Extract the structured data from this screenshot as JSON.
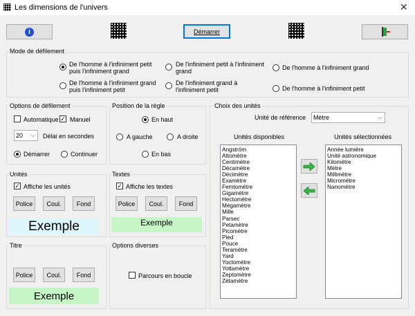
{
  "window": {
    "title": "Les dimensions de l'univers",
    "close_glyph": "✕"
  },
  "toolbar": {
    "start_label": "Démarrer",
    "info_glyph": "i"
  },
  "scroll_mode": {
    "title": "Mode de défilement",
    "options": [
      "De l'homme à l'infiniment petit puis l'infiniment grand",
      "De l'infiniment petit à l'infiniment grand",
      "De l'homme à l'infiniment grand",
      "De l'homme à l'infiniment grand puis l'infiniment petit",
      "De l'infiniment grand à l'infiniment petit",
      "De l'homme à l'infiniment petit"
    ]
  },
  "scroll_options": {
    "title": "Options de défilement",
    "auto_label": "Automatique",
    "manual_label": "Manuel",
    "delay_value": "20",
    "delay_label": "Délai en secondes",
    "start_label": "Démarrer",
    "continue_label": "Continuer"
  },
  "ruler": {
    "title": "Position de la règle",
    "top": "En haut",
    "left": "A gauche",
    "right": "A droite",
    "bottom": "En bas"
  },
  "units_box": {
    "title": "Unités",
    "show_label": "Affiche les unités",
    "font": "Police",
    "color": "Coul.",
    "bg": "Fond",
    "sample": "Exemple",
    "sample_bg": "#ddf6fc"
  },
  "texts_box": {
    "title": "Textes",
    "show_label": "Affiche les textes",
    "font": "Police",
    "color": "Coul.",
    "bg": "Fond",
    "sample": "Exemple",
    "sample_bg": "#c6f5c6"
  },
  "title_box": {
    "title": "Titre",
    "font": "Police",
    "color": "Coul.",
    "bg": "Fond",
    "sample": "Exemple",
    "sample_bg": "#c6f5c6"
  },
  "misc": {
    "title": "Options diverses",
    "loop_label": "Parcours en boucle"
  },
  "units_choice": {
    "title": "Choix des unités",
    "ref_label": "Unité de référence",
    "ref_value": "Mètre",
    "available_label": "Unités disponibles",
    "selected_label": "Unités sélectionnées",
    "available": [
      "Angström",
      "Attomètre",
      "Centimètre",
      "Décamètre",
      "Décimètre",
      "Examètre",
      "Femtomètre",
      "Gigamètre",
      "Hectomètre",
      "Mégamètre",
      "Mille",
      "Parsec",
      "Petamètre",
      "Picomètre",
      "Pied",
      "Pouce",
      "Teramètre",
      "Yard",
      "Yoctomètre",
      "Yottamètre",
      "Zeptomètre",
      "Zétamètre"
    ],
    "selected": [
      "Année lumière",
      "Unité astronomique",
      "Kilomètre",
      "Mètre",
      "Millimètre",
      "Micromètre",
      "Nanomètre"
    ],
    "arrow_color": "#39b54a"
  }
}
